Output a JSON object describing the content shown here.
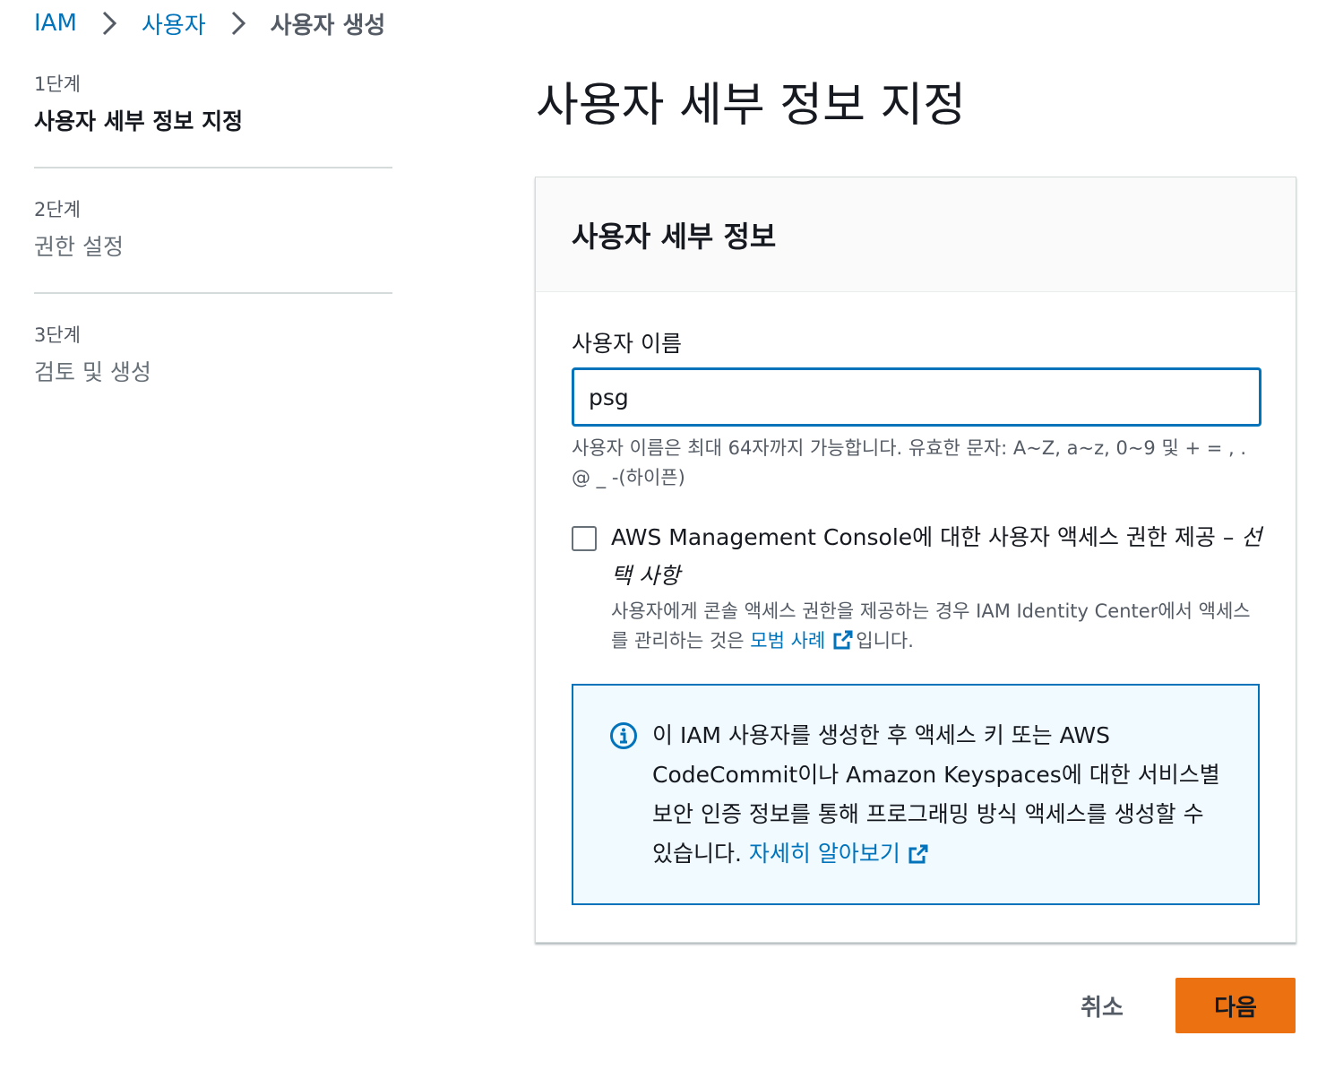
{
  "breadcrumb": {
    "items": [
      "IAM",
      "사용자",
      "사용자 생성"
    ]
  },
  "steps": [
    {
      "number": "1단계",
      "title": "사용자 세부 정보 지정"
    },
    {
      "number": "2단계",
      "title": "권한 설정"
    },
    {
      "number": "3단계",
      "title": "검토 및 생성"
    }
  ],
  "page": {
    "title": "사용자 세부 정보 지정"
  },
  "panel": {
    "title": "사용자 세부 정보",
    "username_label": "사용자 이름",
    "username_value": "psg",
    "username_hint": "사용자 이름은 최대 64자까지 가능합니다. 유효한 문자: A~Z, a~z, 0~9 및 + = , . @ _ -(하이픈)",
    "console_access": {
      "label": "AWS Management Console에 대한 사용자 액세스 권한 제공 –",
      "optional": "선택 사항",
      "checked": false,
      "desc_prefix": "사용자에게 콘솔 액세스 권한을 제공하는 경우 IAM Identity Center에서 액세스를 관리하는 것은",
      "desc_link": "모범 사례",
      "desc_suffix": "입니다."
    },
    "info": {
      "text": "이 IAM 사용자를 생성한 후 액세스 키 또는 AWS CodeCommit이나 Amazon Keyspaces에 대한 서비스별 보안 인증 정보를 통해 프로그래밍 방식 액세스를 생성할 수 있습니다.",
      "link": "자세히 알아보기"
    }
  },
  "actions": {
    "cancel": "취소",
    "next": "다음"
  },
  "colors": {
    "link": "#0073bb",
    "primary_button": "#ec7211",
    "info_bg": "#f1faff",
    "text": "#16191f",
    "secondary_text": "#545b64"
  },
  "icons": {
    "breadcrumb_separator": "chevron-right-icon",
    "external_link": "external-link-icon",
    "info": "info-icon"
  }
}
